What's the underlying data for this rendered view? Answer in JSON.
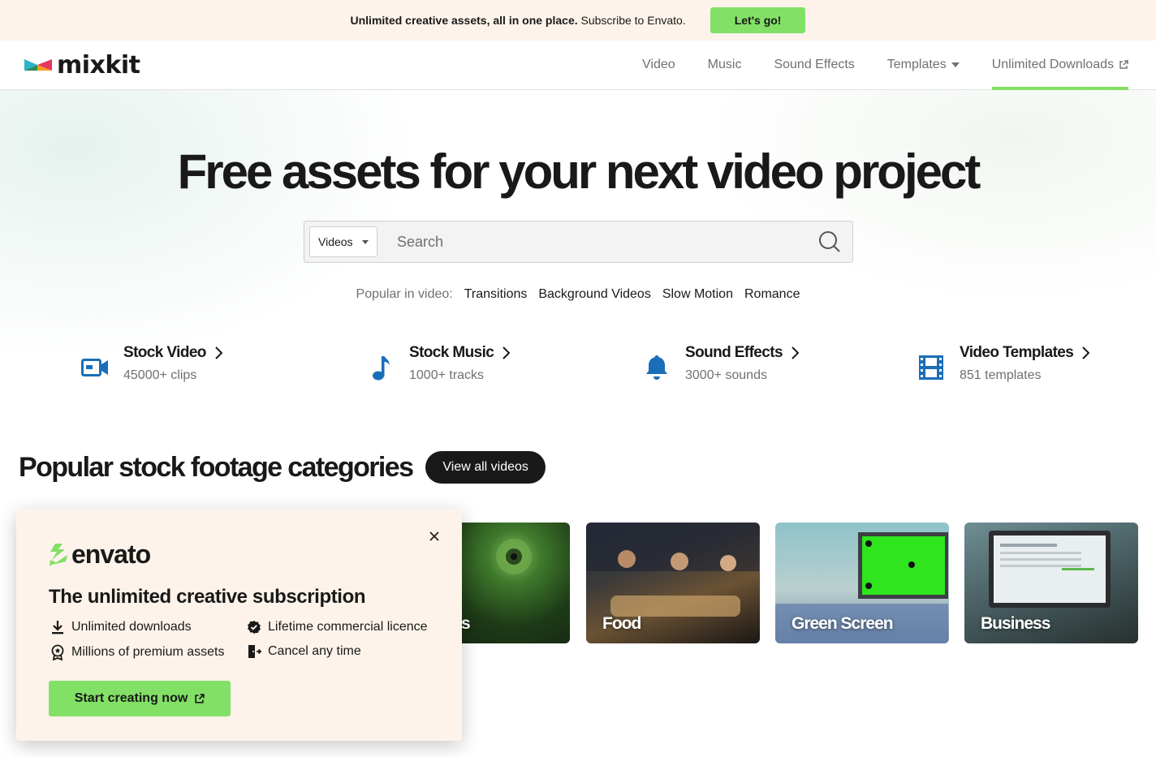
{
  "promo": {
    "text_bold": "Unlimited creative assets, all in one place.",
    "text_rest": "Subscribe to Envato.",
    "cta": "Let's go!"
  },
  "header": {
    "logo": "mixkit",
    "nav": [
      {
        "label": "Video"
      },
      {
        "label": "Music"
      },
      {
        "label": "Sound Effects"
      },
      {
        "label": "Templates"
      },
      {
        "label": "Unlimited Downloads"
      }
    ]
  },
  "hero": {
    "title": "Free assets for your next video project",
    "search": {
      "select_value": "Videos",
      "placeholder": "Search"
    },
    "popular_label": "Popular in video:",
    "popular_links": [
      "Transitions",
      "Background Videos",
      "Slow Motion",
      "Romance"
    ],
    "categories": [
      {
        "title": "Stock Video",
        "sub": "45000+ clips",
        "icon": "video-camera-icon"
      },
      {
        "title": "Stock Music",
        "sub": "1000+ tracks",
        "icon": "music-note-icon"
      },
      {
        "title": "Sound Effects",
        "sub": "3000+ sounds",
        "icon": "bell-icon"
      },
      {
        "title": "Video Templates",
        "sub": "851 templates",
        "icon": "film-strip-icon"
      }
    ]
  },
  "popular_section": {
    "title": "Popular stock footage categories",
    "view_all": "View all videos",
    "tiles": [
      {
        "label": "s"
      },
      {
        "label": "Food"
      },
      {
        "label": "Green Screen"
      },
      {
        "label": "Business"
      }
    ]
  },
  "popup": {
    "brand": "envato",
    "title": "The unlimited creative subscription",
    "features": [
      {
        "label": "Unlimited downloads",
        "icon": "download-icon"
      },
      {
        "label": "Lifetime commercial licence",
        "icon": "verified-badge-icon"
      },
      {
        "label": "Millions of premium assets",
        "icon": "award-ribbon-icon"
      },
      {
        "label": "Cancel any time",
        "icon": "exit-door-icon"
      }
    ],
    "cta": "Start creating now"
  },
  "colors": {
    "accent_green": "#82e066",
    "icon_blue": "#1a6eb8",
    "promo_bg": "#fdf3ea",
    "text_dark": "#191919",
    "text_muted": "#707070"
  }
}
